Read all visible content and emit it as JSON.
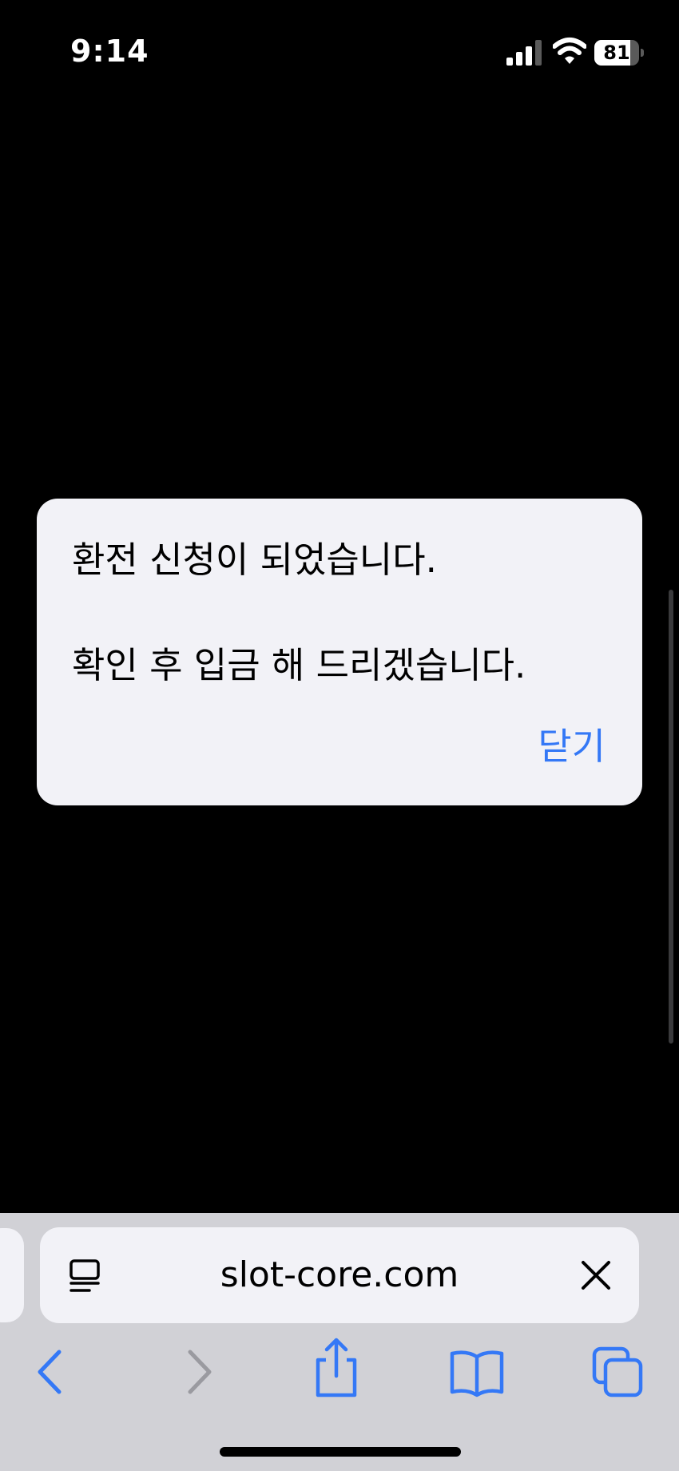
{
  "status_bar": {
    "time": "9:14",
    "battery_level": "81",
    "battery_fraction": 0.81
  },
  "alert": {
    "message": "환전 신청이 되었습니다.\n\n확인 후 입금 해 드리겠습니다.",
    "close_label": "닫기",
    "accent_color": "#3478f6"
  },
  "browser": {
    "url": "slot-core.com",
    "icons": {
      "reader": "reader-mode-icon",
      "clear": "close-icon",
      "back": "chevron-left-icon",
      "forward": "chevron-right-icon",
      "share": "share-icon",
      "bookmarks": "book-icon",
      "tabs": "tabs-icon"
    }
  }
}
